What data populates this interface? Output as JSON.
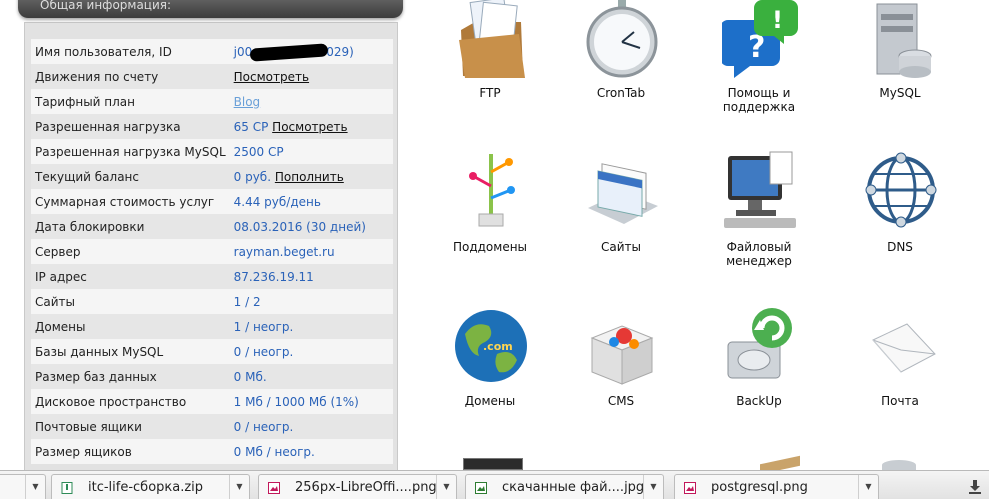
{
  "panel": {
    "title": "Общая информация:",
    "rows": [
      {
        "label": "Имя пользователя, ID",
        "value_pre": "j00",
        "value_post": "029)"
      },
      {
        "label": "Движения по счету",
        "value": "",
        "link": "Посмотреть"
      },
      {
        "label": "Тарифный план",
        "value": "",
        "link_light": "Blog"
      },
      {
        "label": "Разрешенная нагрузка",
        "value": "65 CP",
        "link": "Посмотреть"
      },
      {
        "label": "Разрешенная нагрузка MySQL",
        "value": "2500 CP"
      },
      {
        "label": "Текущий баланс",
        "value": "0 руб.",
        "link": "Пополнить"
      },
      {
        "label": "Суммарная стоимость услуг",
        "value": "4.44 руб/день"
      },
      {
        "label": "Дата блокировки",
        "value": "08.03.2016 (30 дней)"
      },
      {
        "label": "Сервер",
        "value": "rayman.beget.ru"
      },
      {
        "label": "IP адрес",
        "value": "87.236.19.11"
      },
      {
        "label": "Сайты",
        "value": "1 / 2"
      },
      {
        "label": "Домены",
        "value": "1 / неогр."
      },
      {
        "label": "Базы данных MySQL",
        "value": "0 / неогр."
      },
      {
        "label": "Размер баз данных",
        "value": "0 Мб."
      },
      {
        "label": "Дисковое пространство",
        "value": "1 Мб / 1000 Мб (1%)"
      },
      {
        "label": "Почтовые ящики",
        "value": "0 / неогр."
      },
      {
        "label": "Размер ящиков",
        "value": "0 Мб / неогр."
      }
    ]
  },
  "tiles": [
    {
      "label": "FTP",
      "icon": "ftp-folder-icon"
    },
    {
      "label": "CronTab",
      "icon": "clock-icon"
    },
    {
      "label": "Помощь и\nподдержка",
      "icon": "help-bubbles-icon"
    },
    {
      "label": "MySQL",
      "icon": "database-server-icon"
    },
    {
      "label": "Поддомены",
      "icon": "subdomain-tree-icon"
    },
    {
      "label": "Сайты",
      "icon": "websites-stack-icon"
    },
    {
      "label": "Файловый\nменеджер",
      "icon": "file-manager-monitor-icon"
    },
    {
      "label": "DNS",
      "icon": "dns-globe-network-icon"
    },
    {
      "label": "Домены",
      "icon": "domains-globe-icon"
    },
    {
      "label": "CMS",
      "icon": "cms-box-icon"
    },
    {
      "label": "BackUp",
      "icon": "backup-disk-icon"
    },
    {
      "label": "Почта",
      "icon": "mail-envelope-icon"
    }
  ],
  "downloads": [
    {
      "name": "itc-life-сборка.zip",
      "icon": "zip-file-icon"
    },
    {
      "name": "256px-LibreOffi....png",
      "icon": "image-file-icon"
    },
    {
      "name": "скачанные фай....jpg",
      "icon": "image-file-icon"
    },
    {
      "name": "postgresql.png",
      "icon": "image-file-icon"
    }
  ],
  "colors": {
    "value_blue": "#2a62b8",
    "header_dark": "#4a4a4a",
    "panel_bg": "#e2e2e2"
  }
}
